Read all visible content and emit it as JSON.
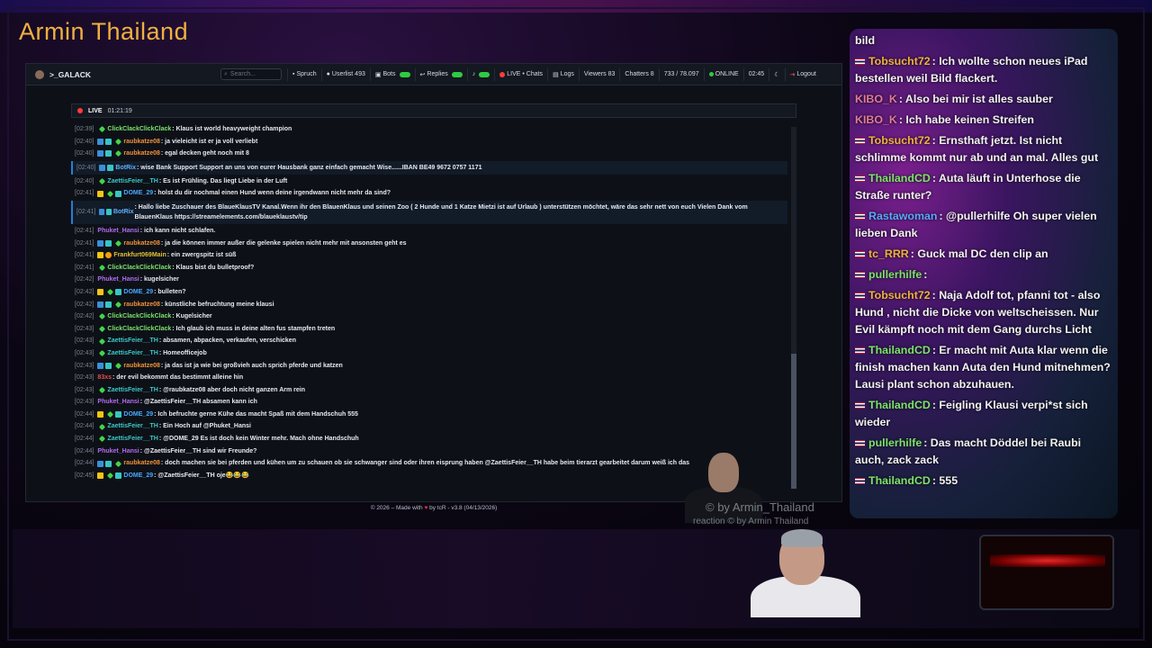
{
  "overlay": {
    "streamer_name": "Armin Thailand",
    "watermark_main": "© by Armin_Thailand",
    "watermark_reaction": "reaction  © by Armin Thailand"
  },
  "navbar": {
    "brand": ">_GALACK",
    "search_placeholder": "Search...",
    "items": {
      "spruch": "Spruch",
      "userlist": "Userlist 493",
      "bots": "Bots",
      "replies": "Replies",
      "live_chats": "LIVE • Chats",
      "logs": "Logs",
      "viewers": "Viewers 83",
      "chatters": "Chatters 8",
      "counter": "733 / 78.097",
      "online": "ONLINE",
      "time": "02:45",
      "logout": "Logout"
    }
  },
  "live_bar": {
    "label": "LIVE",
    "uptime": "01:21:19"
  },
  "colors": {
    "gold": "#f0b040",
    "green_user": "#7de36b",
    "orange_user": "#f0923a",
    "teal_user": "#3cc8c8",
    "purple_user": "#b36cf0",
    "blue_user": "#4aa8ff",
    "yellow_user": "#e0c038",
    "red_user": "#e05050",
    "bot_user": "#5fb2ff"
  },
  "chat_messages": [
    {
      "ts": "[02:39]",
      "badges": [
        "green"
      ],
      "user": "ClickClackClickClack",
      "color": "#7de36b",
      "text": ": Klaus ist world heavyweight champion"
    },
    {
      "ts": "[02:40]",
      "badges": [
        "blue",
        "teal",
        "green"
      ],
      "user": "raubkatze08",
      "color": "#f0923a",
      "text": ": ja vieleicht ist er ja voll verliebt"
    },
    {
      "ts": "[02:40]",
      "badges": [
        "blue",
        "teal",
        "green"
      ],
      "user": "raubkatze08",
      "color": "#f0923a",
      "text": ": egal decken geht noch mit 8"
    },
    {
      "ts": "[02:40]",
      "badges": [
        "blue",
        "teal"
      ],
      "user": "BotRix",
      "color": "#5fb2ff",
      "text": ": wise Bank Support Support an uns von eurer Hausbank ganz einfach gemacht Wise......IBAN BE49 9672 0757 1171",
      "hl": true
    },
    {
      "ts": "[02:40]",
      "badges": [
        "green"
      ],
      "user": "ZaettisFeier__TH",
      "color": "#3cc8c8",
      "text": ": Es ist Frühling. Das liegt Liebe in der Luft"
    },
    {
      "ts": "[02:41]",
      "badges": [
        "crown",
        "green",
        "teal"
      ],
      "user": "DOME_29",
      "color": "#4aa8ff",
      "text": ": holst du dir nochmal einen Hund wenn deine irgendwann nicht mehr da sind?"
    },
    {
      "ts": "[02:41]",
      "badges": [
        "blue",
        "teal"
      ],
      "user": "BotRix",
      "color": "#5fb2ff",
      "text": ": Hallo liebe Zuschauer des BlaueKlausTV Kanal.Wenn ihr den BlauenKlaus und seinen Zoo ( 2 Hunde und 1 Katze Mietzi ist auf Urlaub ) unterstützen möchtet, wäre das sehr nett von euch Vielen Dank vom BlauenKlaus https://streamelements.com/blaueklaustv/tip",
      "hl": true
    },
    {
      "ts": "[02:41]",
      "badges": [],
      "user": "Phuket_Hansi",
      "color": "#b36cf0",
      "text": ": ich kann nicht schlafen."
    },
    {
      "ts": "[02:41]",
      "badges": [
        "blue",
        "teal",
        "green"
      ],
      "user": "raubkatze08",
      "color": "#f0923a",
      "text": ": ja die können immer außer die gelenke spielen nicht mehr mit ansonsten geht es"
    },
    {
      "ts": "[02:41]",
      "badges": [
        "crown",
        "orange"
      ],
      "user": "Frankfurt069Main",
      "color": "#e0c038",
      "text": ": ein zwergspitz ist süß"
    },
    {
      "ts": "[02:41]",
      "badges": [
        "green"
      ],
      "user": "ClickClackClickClack",
      "color": "#7de36b",
      "text": ": Klaus bist du bulletproof?"
    },
    {
      "ts": "[02:42]",
      "badges": [],
      "user": "Phuket_Hansi",
      "color": "#b36cf0",
      "text": ": kugelsicher"
    },
    {
      "ts": "[02:42]",
      "badges": [
        "crown",
        "green",
        "teal"
      ],
      "user": "DOME_29",
      "color": "#4aa8ff",
      "text": ": bulleten?"
    },
    {
      "ts": "[02:42]",
      "badges": [
        "blue",
        "teal",
        "green"
      ],
      "user": "raubkatze08",
      "color": "#f0923a",
      "text": ": künstliche befruchtung meine klausi"
    },
    {
      "ts": "[02:42]",
      "badges": [
        "green"
      ],
      "user": "ClickClackClickClack",
      "color": "#7de36b",
      "text": ": Kugelsicher"
    },
    {
      "ts": "[02:43]",
      "badges": [
        "green"
      ],
      "user": "ClickClackClickClack",
      "color": "#7de36b",
      "text": ": Ich glaub ich muss in deine alten fus stampfen treten"
    },
    {
      "ts": "[02:43]",
      "badges": [
        "green"
      ],
      "user": "ZaettisFeier__TH",
      "color": "#3cc8c8",
      "text": ": absamen, abpacken, verkaufen, verschicken"
    },
    {
      "ts": "[02:43]",
      "badges": [
        "green"
      ],
      "user": "ZaettisFeier__TH",
      "color": "#3cc8c8",
      "text": ": Homeofficejob"
    },
    {
      "ts": "[02:43]",
      "badges": [
        "blue",
        "teal",
        "green"
      ],
      "user": "raubkatze08",
      "color": "#f0923a",
      "text": ": ja das ist ja wie bei großvieh auch sprich pferde und katzen"
    },
    {
      "ts": "[02:43]",
      "badges": [],
      "user": "83xs",
      "color": "#e05050",
      "text": ": der evil bekommt das bestimmt alleine hin"
    },
    {
      "ts": "[02:43]",
      "badges": [
        "green"
      ],
      "user": "ZaettisFeier__TH",
      "color": "#3cc8c8",
      "text": ": @raubkatze08 aber doch nicht ganzen Arm rein"
    },
    {
      "ts": "[02:43]",
      "badges": [],
      "user": "Phuket_Hansi",
      "color": "#b36cf0",
      "text": ": @ZaettisFeier__TH absamen kann ich"
    },
    {
      "ts": "[02:44]",
      "badges": [
        "crown",
        "green",
        "teal"
      ],
      "user": "DOME_29",
      "color": "#4aa8ff",
      "text": ": Ich befruchte gerne Kühe das macht Spaß mit dem Handschuh 555"
    },
    {
      "ts": "[02:44]",
      "badges": [
        "green"
      ],
      "user": "ZaettisFeier__TH",
      "color": "#3cc8c8",
      "text": ": Ein Hoch auf @Phuket_Hansi"
    },
    {
      "ts": "[02:44]",
      "badges": [
        "green"
      ],
      "user": "ZaettisFeier__TH",
      "color": "#3cc8c8",
      "text": ": @DOME_29 Es ist doch kein Winter mehr. Mach ohne Handschuh"
    },
    {
      "ts": "[02:44]",
      "badges": [],
      "user": "Phuket_Hansi",
      "color": "#b36cf0",
      "text": ": @ZaettisFeier__TH sind wir Freunde?"
    },
    {
      "ts": "[02:44]",
      "badges": [
        "blue",
        "teal",
        "green"
      ],
      "user": "raubkatze08",
      "color": "#f0923a",
      "text": ": doch machen sie bei pferden und kühen um zu schauen ob sie schwanger sind oder ihren eisprung haben @ZaettisFeier__TH habe beim tierarzt gearbeitet darum weiß ich das"
    },
    {
      "ts": "[02:45]",
      "badges": [
        "crown",
        "green",
        "teal"
      ],
      "user": "DOME_29",
      "color": "#4aa8ff",
      "text": ": @ZaettisFeier__TH oje😂😂😂"
    }
  ],
  "footer": {
    "pre": "© 2026 – Made with",
    "post": "by tcR - v3.8 (04/13/2026)"
  },
  "side_chat": [
    {
      "flag": false,
      "user": "",
      "color": "#ffffff",
      "text": "bild"
    },
    {
      "flag": true,
      "user": "Tobsucht72",
      "color": "#f0b040",
      "text": ": Ich wollte schon neues iPad bestellen weil Bild flackert."
    },
    {
      "flag": false,
      "user": "KIBO_K",
      "color": "#e07c98",
      "text": ": Also bei mir ist alles sauber"
    },
    {
      "flag": false,
      "user": "KIBO_K",
      "color": "#e07c98",
      "text": ": Ich habe keinen Streifen"
    },
    {
      "flag": true,
      "user": "Tobsucht72",
      "color": "#f0b040",
      "text": ": Ernsthaft jetzt. Ist nicht schlimme kommt nur ab und an mal. Alles gut"
    },
    {
      "flag": true,
      "user": "ThailandCD",
      "color": "#7de36b",
      "text": ": Auta läuft in Unterhose die Straße runter?"
    },
    {
      "flag": true,
      "user": "Rastawoman",
      "color": "#5aa8ff",
      "text": ": @pullerhilfe Oh super vielen lieben Dank"
    },
    {
      "flag": true,
      "user": "tc_RRR",
      "color": "#f0b040",
      "text": ": Guck mal DC den clip an"
    },
    {
      "flag": true,
      "user": "pullerhilfe",
      "color": "#7de36b",
      "text": ":"
    },
    {
      "flag": true,
      "user": "Tobsucht72",
      "color": "#f0b040",
      "text": ": Naja Adolf tot, pfanni tot - also Hund , nicht die Dicke von weltscheissen. Nur Evil kämpft noch mit dem Gang durchs Licht"
    },
    {
      "flag": true,
      "user": "ThailandCD",
      "color": "#7de36b",
      "text": ": Er macht mit Auta klar wenn die finish machen kann Auta den Hund mitnehmen? Lausi plant schon abzuhauen."
    },
    {
      "flag": true,
      "user": "ThailandCD",
      "color": "#7de36b",
      "text": ": Feigling Klausi verpi*st sich wieder"
    },
    {
      "flag": true,
      "user": "pullerhilfe",
      "color": "#7de36b",
      "text": ": Das macht Döddel bei Raubi auch, zack zack"
    },
    {
      "flag": true,
      "user": "ThailandCD",
      "color": "#7de36b",
      "text": ": 555"
    }
  ]
}
